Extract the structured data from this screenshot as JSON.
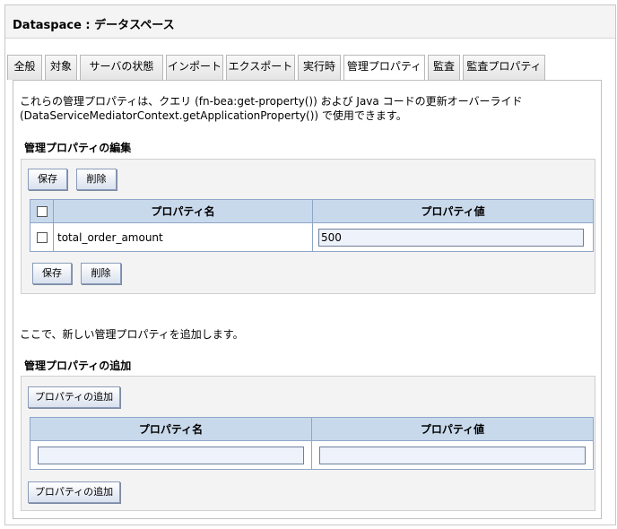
{
  "window": {
    "title": "Dataspace : データスペース"
  },
  "tabs": [
    {
      "label": "全般",
      "active": false
    },
    {
      "label": "対象",
      "active": false
    },
    {
      "label": "サーバの状態",
      "active": false
    },
    {
      "label": "インポート",
      "active": false
    },
    {
      "label": "エクスポート",
      "active": false
    },
    {
      "label": "実行時",
      "active": false
    },
    {
      "label": "管理プロパティ",
      "active": true
    },
    {
      "label": "監査",
      "active": false
    },
    {
      "label": "監査プロパティ",
      "active": false
    }
  ],
  "description": {
    "line1": "これらの管理プロパティは、クエリ (fn-bea:get-property()) および Java コードの更新オーバーライド",
    "line2": "(DataServiceMediatorContext.getApplicationProperty()) で使用できます。"
  },
  "edit_section": {
    "title": "管理プロパティの編集",
    "save_label": "保存",
    "delete_label": "削除",
    "table": {
      "columns": [
        "プロパティ名",
        "プロパティ値"
      ],
      "rows": [
        {
          "name": "total_order_amount",
          "value": "500"
        }
      ]
    }
  },
  "add_section": {
    "intro": "ここで、新しい管理プロパティを追加します。",
    "title": "管理プロパティの追加",
    "add_label": "プロパティの追加",
    "table": {
      "columns": [
        "プロパティ名",
        "プロパティ値"
      ],
      "name_value": "",
      "value_value": ""
    }
  }
}
